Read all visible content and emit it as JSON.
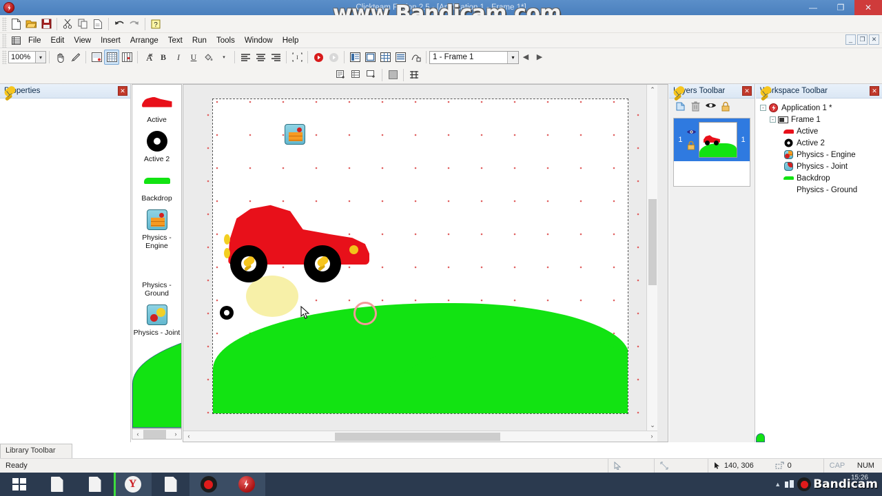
{
  "window": {
    "title": "Clickteam Fusion 2.5 - [Application 1 - Frame 1*]",
    "minimize": "—",
    "maximize": "❐",
    "close": "✕",
    "watermark": "www.Bandicam.com"
  },
  "mdi_buttons": {
    "minimize": "_",
    "restore": "❐",
    "close": "✕"
  },
  "menu": {
    "items": [
      "File",
      "Edit",
      "View",
      "Insert",
      "Arrange",
      "Text",
      "Run",
      "Tools",
      "Window",
      "Help"
    ]
  },
  "toolbar_file": {
    "buttons": [
      {
        "name": "new-file-icon",
        "glyph": "🗋"
      },
      {
        "name": "open-file-icon",
        "glyph": "📂"
      },
      {
        "name": "save-icon",
        "glyph": "💾"
      },
      {
        "name": "cut-icon",
        "glyph": "✂"
      },
      {
        "name": "copy-icon",
        "glyph": "⧉"
      },
      {
        "name": "paste-icon",
        "glyph": "📋"
      },
      {
        "name": "undo-icon",
        "glyph": "↶"
      },
      {
        "name": "redo-icon",
        "glyph": "↷"
      },
      {
        "name": "help-icon",
        "glyph": "?"
      }
    ]
  },
  "toolbar_edit": {
    "zoom_value": "100%",
    "zoom_dropdown": "▾",
    "buttons": [
      {
        "name": "pan-hand-icon",
        "glyph": "✋"
      },
      {
        "name": "eyedropper-icon",
        "glyph": "✎"
      },
      {
        "name": "frame-properties-icon",
        "glyph": "▤"
      },
      {
        "name": "grid-toggle-icon",
        "glyph": "▦"
      },
      {
        "name": "snap-grid-icon",
        "glyph": "▩"
      },
      {
        "name": "font-icon",
        "glyph": "A"
      },
      {
        "name": "bold-icon",
        "glyph": "B"
      },
      {
        "name": "italic-icon",
        "glyph": "I"
      },
      {
        "name": "underline-icon",
        "glyph": "U"
      },
      {
        "name": "fill-color-icon",
        "glyph": "◣"
      },
      {
        "name": "align-left-icon",
        "glyph": "≡"
      },
      {
        "name": "align-center-icon",
        "glyph": "≡"
      },
      {
        "name": "align-right-icon",
        "glyph": "≡"
      },
      {
        "name": "select-bounds-icon",
        "glyph": "⬚"
      },
      {
        "name": "run-application-icon",
        "glyph": "◆"
      },
      {
        "name": "run-frame-icon",
        "glyph": "◇"
      },
      {
        "name": "storyboard-icon",
        "glyph": "▤"
      },
      {
        "name": "frame-editor-icon",
        "glyph": "❐"
      },
      {
        "name": "event-editor-icon",
        "glyph": "▦"
      },
      {
        "name": "event-list-icon",
        "glyph": "☰"
      },
      {
        "name": "step-through-icon",
        "glyph": "⇥"
      }
    ],
    "frame_selector": "1 - Frame 1",
    "frame_prev": "◀",
    "frame_next": "▶"
  },
  "toolbar_secondary": {
    "buttons": [
      {
        "name": "insert-object-icon",
        "glyph": "▤"
      },
      {
        "name": "insert-frame-icon",
        "glyph": "▤"
      },
      {
        "name": "new-frame-icon",
        "glyph": "❏"
      },
      {
        "name": "color-swatch-icon",
        "glyph": "■"
      },
      {
        "name": "align-grid-icon",
        "glyph": "▥"
      }
    ]
  },
  "properties_panel": {
    "title": "Properties",
    "pin": "📌",
    "close": "✕"
  },
  "object_list": {
    "items": [
      {
        "label": "Active",
        "icon": "car-shape-icon"
      },
      {
        "label": "Active 2",
        "icon": "wheel-shape-icon"
      },
      {
        "label": "Backdrop",
        "icon": "green-ground-icon"
      },
      {
        "label": "Physics - Engine",
        "icon": "physics-engine-icon"
      },
      {
        "label": "Physics - Ground",
        "icon": "physics-ground-icon"
      },
      {
        "label": "Physics - Joint",
        "icon": "physics-joint-icon"
      }
    ]
  },
  "layers_panel": {
    "title": "Layers Toolbar",
    "pin": "📌",
    "close": "✕",
    "tools": [
      {
        "name": "new-layer-icon",
        "glyph": "❐"
      },
      {
        "name": "delete-layer-icon",
        "glyph": "🗑"
      },
      {
        "name": "visibility-icon",
        "glyph": "👁"
      },
      {
        "name": "lock-layer-icon",
        "glyph": "🔒"
      }
    ],
    "rows": [
      {
        "number": "1",
        "count": "1",
        "eye": "👁",
        "lock": "🔒"
      }
    ]
  },
  "workspace_panel": {
    "title": "Workspace Toolbar",
    "pin": "📌",
    "close": "✕",
    "tree": [
      {
        "label": "Application 1 *",
        "depth": 0,
        "expander": "-",
        "icon": "application-icon"
      },
      {
        "label": "Frame 1",
        "depth": 1,
        "expander": "-",
        "icon": "frame-icon"
      },
      {
        "label": "Active",
        "depth": 2,
        "expander": "",
        "icon": "car-shape-icon"
      },
      {
        "label": "Active 2",
        "depth": 2,
        "expander": "",
        "icon": "wheel-shape-icon"
      },
      {
        "label": "Physics - Engine",
        "depth": 2,
        "expander": "",
        "icon": "physics-engine-icon"
      },
      {
        "label": "Physics - Joint",
        "depth": 2,
        "expander": "",
        "icon": "physics-joint-icon"
      },
      {
        "label": "Backdrop",
        "depth": 2,
        "expander": "",
        "icon": "green-ground-icon"
      },
      {
        "label": "Physics - Ground",
        "depth": 2,
        "expander": "",
        "icon": "physics-ground-icon"
      }
    ]
  },
  "library_tab": {
    "label": "Library Toolbar"
  },
  "status_bar": {
    "message": "Ready",
    "coordinates": "140, 306",
    "selection_count": "0",
    "cap": "CAP",
    "num": "NUM",
    "pointer_icon": "➤",
    "size_icon": "⤢",
    "cursor_icon": "➤"
  },
  "taskbar": {
    "start": "start-button",
    "items": [
      {
        "name": "taskbar-document-1",
        "icon": "document-icon"
      },
      {
        "name": "taskbar-document-2",
        "icon": "document-icon"
      },
      {
        "name": "taskbar-yandex",
        "icon": "yandex-icon",
        "label": "Y"
      },
      {
        "name": "taskbar-document-3",
        "icon": "document-icon"
      },
      {
        "name": "taskbar-bandicam",
        "icon": "bandicam-record-icon"
      },
      {
        "name": "taskbar-clickteam-fusion",
        "icon": "clickteam-fusion-icon"
      }
    ],
    "clock": "15:26",
    "tray_expand": "▲",
    "bandicam_label": "Bandicam"
  },
  "canvas": {
    "colors": {
      "car_red": "#e8101a",
      "ground_green": "#12e312",
      "sun_yellow": "#f7f0a8",
      "wheel_black": "#000000",
      "pin_yellow": "#f6c51e",
      "ring_pink": "#f39a9a"
    },
    "objects": [
      {
        "name": "physics-engine-object",
        "label": "Physics - Engine"
      },
      {
        "name": "car-active-object",
        "label": "Active"
      },
      {
        "name": "wheel-front-object",
        "label": "Active 2"
      },
      {
        "name": "wheel-rear-object",
        "label": "Active 2"
      },
      {
        "name": "backdrop-ground-object",
        "label": "Backdrop"
      },
      {
        "name": "physics-ground-object",
        "label": "Physics - Ground"
      },
      {
        "name": "physics-joint-object",
        "label": "Physics - Joint"
      }
    ]
  }
}
